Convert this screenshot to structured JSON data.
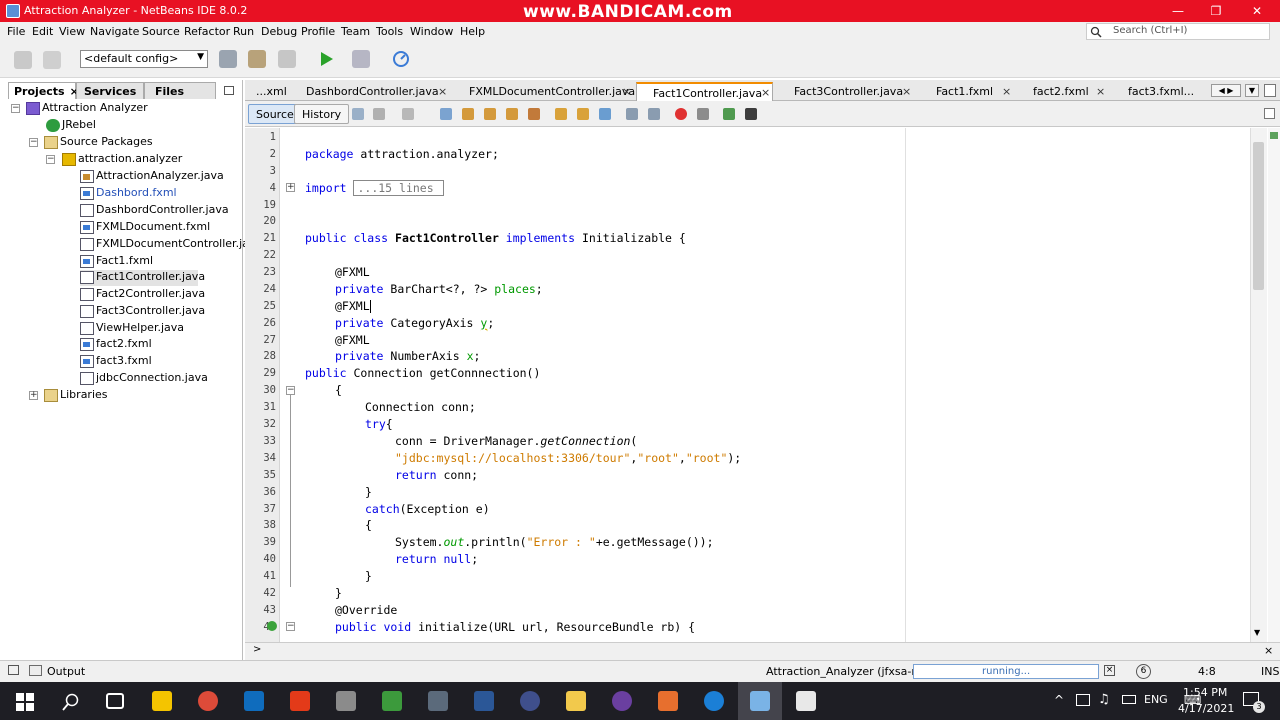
{
  "window": {
    "title": "Attraction Analyzer - NetBeans IDE 8.0.2",
    "watermark": "www.BANDICAM.com",
    "controls": [
      "—",
      "❐",
      "✕"
    ]
  },
  "menu": [
    "File",
    "Edit",
    "View",
    "Navigate",
    "Source",
    "Refactor",
    "Run",
    "Debug",
    "Profile",
    "Team",
    "Tools",
    "Window",
    "Help"
  ],
  "search": {
    "placeholder": "Search (Ctrl+I)"
  },
  "toolbar": {
    "config": "<default config>"
  },
  "panel_tabs": [
    "Projects",
    "Services",
    "Files"
  ],
  "tree": {
    "project": "Attraction Analyzer",
    "jrebel": "JRebel",
    "source_packages": "Source Packages",
    "package": "attraction.analyzer",
    "files": [
      "AttractionAnalyzer.java",
      "Dashbord.fxml",
      "DashbordController.java",
      "FXMLDocument.fxml",
      "FXMLDocumentController.java",
      "Fact1.fxml",
      "Fact1Controller.java",
      "Fact2Controller.java",
      "Fact3Controller.java",
      "ViewHelper.java",
      "fact2.fxml",
      "fact3.fxml",
      "jdbcConnection.java"
    ],
    "libraries": "Libraries"
  },
  "editor_tabs": [
    "...xml",
    "DashbordController.java",
    "FXMLDocumentController.java",
    "Fact1Controller.java",
    "Fact3Controller.java",
    "Fact1.fxml",
    "fact2.fxml",
    "fact3.fxml..."
  ],
  "editor_toolbar": {
    "source": "Source",
    "history": "History"
  },
  "line_numbers": [
    "1",
    "2",
    "3",
    "4",
    "19",
    "20",
    "21",
    "22",
    "23",
    "24",
    "25",
    "26",
    "27",
    "28",
    "29",
    "30",
    "31",
    "32",
    "33",
    "34",
    "35",
    "36",
    "37",
    "38",
    "39",
    "40",
    "41",
    "42",
    "43",
    "44"
  ],
  "code": {
    "l2_kw": "package",
    "l2_rest": " attraction.analyzer;",
    "l4_kw": "import",
    "l4_fold": "...15 lines",
    "l21_kw": "public class",
    "l21_mid": " Fact1Controller ",
    "l21_kw2": "implements",
    "l21_rest": " Initializable {",
    "ann_fxml": "@FXML",
    "kw_private": "private",
    "l24_type": " BarChart<?, ?> ",
    "l24_field": "places",
    "l26_type": " CategoryAxis ",
    "l26_field": "y",
    "l28_type": " NumberAxis ",
    "l28_field": "x",
    "semicolon": ";",
    "kw_public": "public",
    "l29_rest": " Connection getConnnection()",
    "brace_open": "{",
    "brace_close": "}",
    "l31": "Connection conn;",
    "kw_try": "try",
    "l33_pre": "conn = DriverManager.",
    "l33_method": "getConnection",
    "l33_paren": "(",
    "l34_s1": "\"jdbc:mysql://localhost:3306/tour\"",
    "l34_s2": "\"root\"",
    "l34_s3": "\"root\"",
    "comma": ",",
    "l34_end": ");",
    "kw_return": "return",
    "l35_rest": " conn;",
    "kw_catch": "catch",
    "l37_rest": "(Exception e)",
    "l39_pre": "System.",
    "l39_out": "out",
    "l39_mid": ".println(",
    "l39_str": "\"Error : \"",
    "l39_end": "+e.getMessage());",
    "kw_null": "null",
    "l43": "@Override",
    "l44_kw": "public void",
    "l44_rest": " initialize(URL url, ResourceBundle rb) {"
  },
  "status": {
    "output": "Output",
    "run_target": "Attraction_Analyzer (jfxsa-run)",
    "progress": "running...",
    "badge": "6",
    "position": "4:8",
    "mode": "INS"
  },
  "tray": {
    "lang": "ENG",
    "time": "1:54 PM",
    "date": "4/17/2021",
    "notif": "3"
  }
}
